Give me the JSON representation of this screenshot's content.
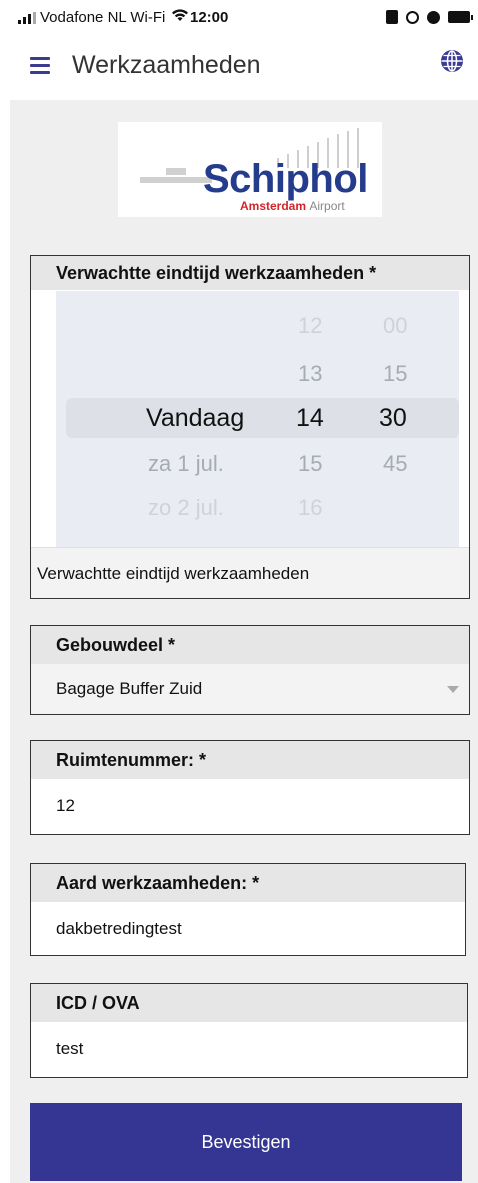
{
  "status_bar": {
    "carrier": "Vodafone NL Wi-Fi",
    "time": "12:00"
  },
  "app_bar": {
    "title": "Werkzaamheden",
    "menu_icon": "hamburger-menu-icon",
    "language_icon": "globe-icon"
  },
  "logo": {
    "name": "Schiphol",
    "subtitle_red": "Amsterdam",
    "subtitle_grey": "Airport"
  },
  "end_time": {
    "label": "Verwachtte eindtijd werkzaamheden *",
    "footer_text": "Verwachtte eindtijd werkzaamheden",
    "picker": {
      "day_column": [
        "Vandaag",
        "za 1 jul.",
        "zo 2 jul."
      ],
      "hour_column": [
        "12",
        "13",
        "14",
        "15",
        "16"
      ],
      "minute_column": [
        "00",
        "15",
        "30",
        "45"
      ],
      "selected_day": "Vandaag",
      "selected_hour": "14",
      "selected_minute": "30"
    }
  },
  "gebouwdeel": {
    "label": "Gebouwdeel *",
    "value": "Bagage Buffer Zuid"
  },
  "ruimtenummer": {
    "label": "Ruimtenummer: *",
    "value": "12"
  },
  "aard": {
    "label": "Aard werkzaamheden: *",
    "value": "dakbetredingtest"
  },
  "icd": {
    "label": "ICD / OVA",
    "value": "test"
  },
  "confirm_button": {
    "label": "Bevestigen"
  },
  "colors": {
    "primary": "#353594",
    "header_bg": "#e6e6e6",
    "page_bg": "#efefef",
    "logo_blue": "#253b8c",
    "logo_red": "#d2242a"
  }
}
